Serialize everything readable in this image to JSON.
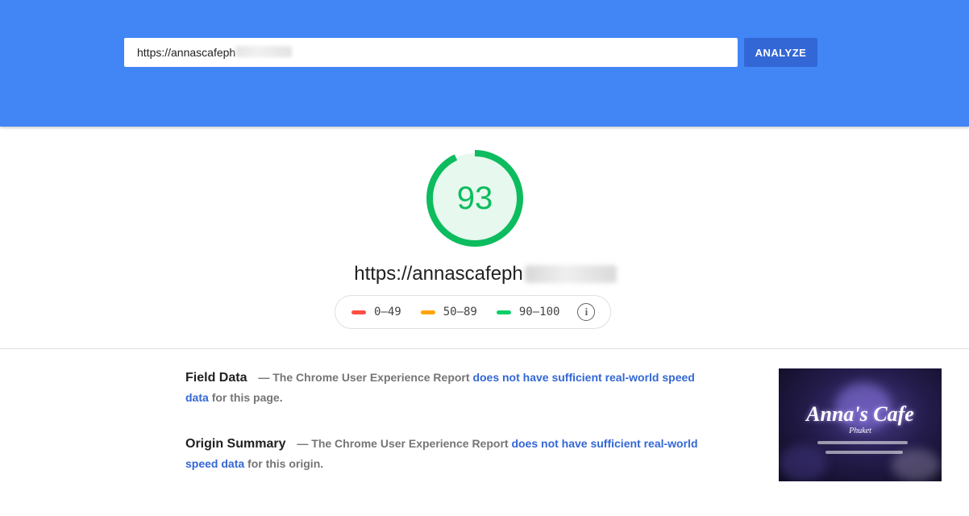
{
  "search": {
    "url_value": "https://annascafeph",
    "analyze_label": "ANALYZE"
  },
  "score": {
    "value": "93",
    "fraction": 0.93,
    "color": "#0cbc5e",
    "bg_color": "#e7f8ee"
  },
  "tested_url": "https://annascafeph",
  "legend": {
    "items": [
      {
        "label": "0–49",
        "color": "#ff4e42"
      },
      {
        "label": "50–89",
        "color": "#ffa400"
      },
      {
        "label": "90–100",
        "color": "#0cce6b"
      }
    ],
    "info_icon": "info-icon"
  },
  "field_data": {
    "title": "Field Data",
    "prefix": "— The Chrome User Experience Report",
    "link": "does not have sufficient real-world speed data",
    "suffix": "for this page."
  },
  "origin_summary": {
    "title": "Origin Summary",
    "prefix": "— The Chrome User Experience Report",
    "link": "does not have sufficient real-world speed data",
    "suffix": "for this origin."
  },
  "thumbnail": {
    "title": "Anna's Cafe",
    "subtitle": "Phuket"
  },
  "colors": {
    "header": "#4285f4",
    "button": "#3367d6",
    "link": "#3367d6"
  }
}
